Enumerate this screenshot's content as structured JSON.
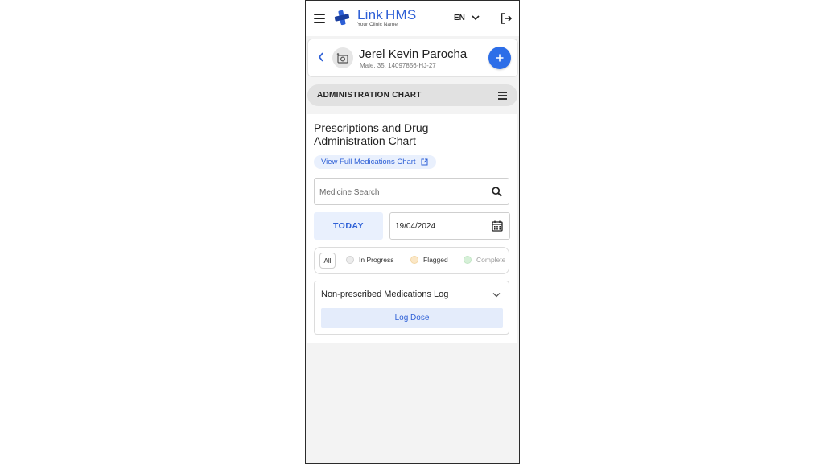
{
  "header": {
    "brand_link": "Link",
    "brand_hms": "HMS",
    "clinic_name": "Your Clinic Name",
    "language": "EN"
  },
  "patient": {
    "name": "Jerel Kevin Parocha",
    "meta": "Male, 35, 14097856-HJ-27"
  },
  "section": {
    "title": "ADMINISTRATION CHART"
  },
  "chart": {
    "heading": "Prescriptions and Drug Administration Chart",
    "view_full_link": "View Full Medications Chart",
    "search_placeholder": "Medicine Search",
    "today_label": "TODAY",
    "date_value": "19/04/2024",
    "filters": [
      {
        "label": "All"
      },
      {
        "label": "In Progress",
        "color": "#e8e8e8"
      },
      {
        "label": "Flagged",
        "color": "#fbe7c6"
      },
      {
        "label": "Complete",
        "color": "#d6f0d8"
      }
    ],
    "log": {
      "title": "Non-prescribed Medications Log",
      "button": "Log Dose"
    }
  },
  "colors": {
    "accent": "#2d5fd6",
    "fab": "#2d6ee8"
  }
}
